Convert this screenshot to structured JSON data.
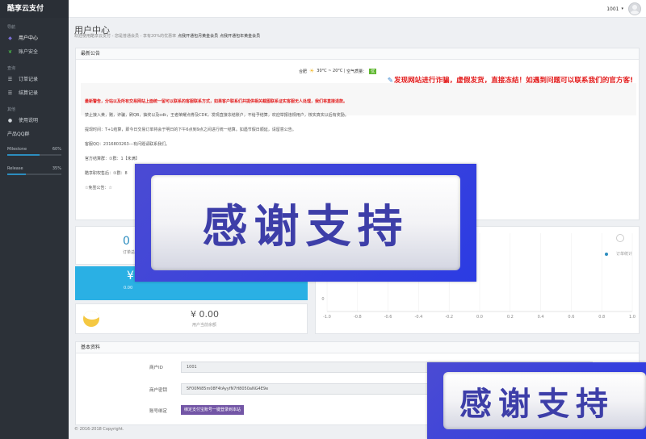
{
  "app": {
    "brand": "酷享云支付"
  },
  "sidebar": {
    "section1": "导航",
    "items1": [
      {
        "label": "用户中心",
        "icon": "user-icon"
      },
      {
        "label": "账户安全",
        "icon": "leaf-icon"
      }
    ],
    "section2": "查询",
    "items2": [
      {
        "label": "订单记录",
        "icon": "list-icon"
      },
      {
        "label": "结算记录",
        "icon": "list-icon"
      }
    ],
    "section3": "其他",
    "items3": [
      {
        "label": "使用说明",
        "icon": "info-icon"
      },
      {
        "label": "产品QQ群",
        "icon": ""
      }
    ],
    "progress": [
      {
        "label": "Milestone",
        "percent_text": "60%",
        "value": 0.6
      },
      {
        "label": "Release",
        "percent_text": "35%",
        "value": 0.35
      }
    ]
  },
  "topbar": {
    "user_name": "1001",
    "caret": "▾"
  },
  "header": {
    "title": "用户中心",
    "subtitle": "欢迎使用酷享云支付 - 您是普通会员 - 享有20%的优惠率",
    "link1": "点我开通包月黄金会员",
    "link2": "点我开通包年黄金会员"
  },
  "notice": {
    "title": "最新公告",
    "weather_city": "合肥",
    "weather_temp": "30°C ~ 20°C",
    "weather_aqi_label": "空气质量：",
    "weather_aqi": "优",
    "scam_line": "发现网站进行诈骗，虚假发货，直接冻结！如遇到问题可以联系我们的官方客!",
    "warning": "最新警告，分站以及所有交易网站上面统一留可以联系的客服联系方式，如果客户联系们并提供相关截图联系证实客服无人处理，我们将直接退款。",
    "lines": [
      "禁止接入黄，赌，诈骗，刷QB，抽奖以及cdk，王者荣耀点券及CDK，发现直接冻结账户，不给予结算，欢迎举报违规用户，核实真实以后有奖励。",
      "提现时间：T+1结算，即今日交易订单将会于明日的下午6点到9点之间进行统一结算。如遇节假日顺延，请留意公告。",
      "客服QQ：2316803263---有问题请联系我们。",
      "官方结算群：①群：1【未满】",
      "酷享职权售后：①群：8",
      "☆免签公告：☆"
    ]
  },
  "stats": {
    "orders_value": "0",
    "orders_label": "订单总数",
    "today_value": "¥",
    "today_label": "0.00",
    "balance": "¥ 0.00",
    "balance_label": "用户当前余额",
    "legend": "订单统计"
  },
  "chart_data": {
    "type": "line",
    "x_ticks": [
      "-1.0",
      "-0.8",
      "-0.6",
      "-0.4",
      "-0.2",
      "0.0",
      "0.2",
      "0.4",
      "0.6",
      "0.8",
      "1.0"
    ],
    "y_ticks": [
      "0"
    ],
    "series": []
  },
  "profile": {
    "title": "基本资料",
    "uid_label": "商户ID",
    "uid_value": "1001",
    "key_label": "商户密钥",
    "key_value": "5F00Mi85m08F4tAyyfN7H8050aNG4E9e",
    "bind_label": "账号绑定",
    "bind_button": "绑定支付宝账号一键登录到本站"
  },
  "footer": {
    "copyright": "© 2016-2018 Copyright."
  },
  "overlays": {
    "banner1": "感谢支持",
    "banner2": "感谢支持"
  }
}
